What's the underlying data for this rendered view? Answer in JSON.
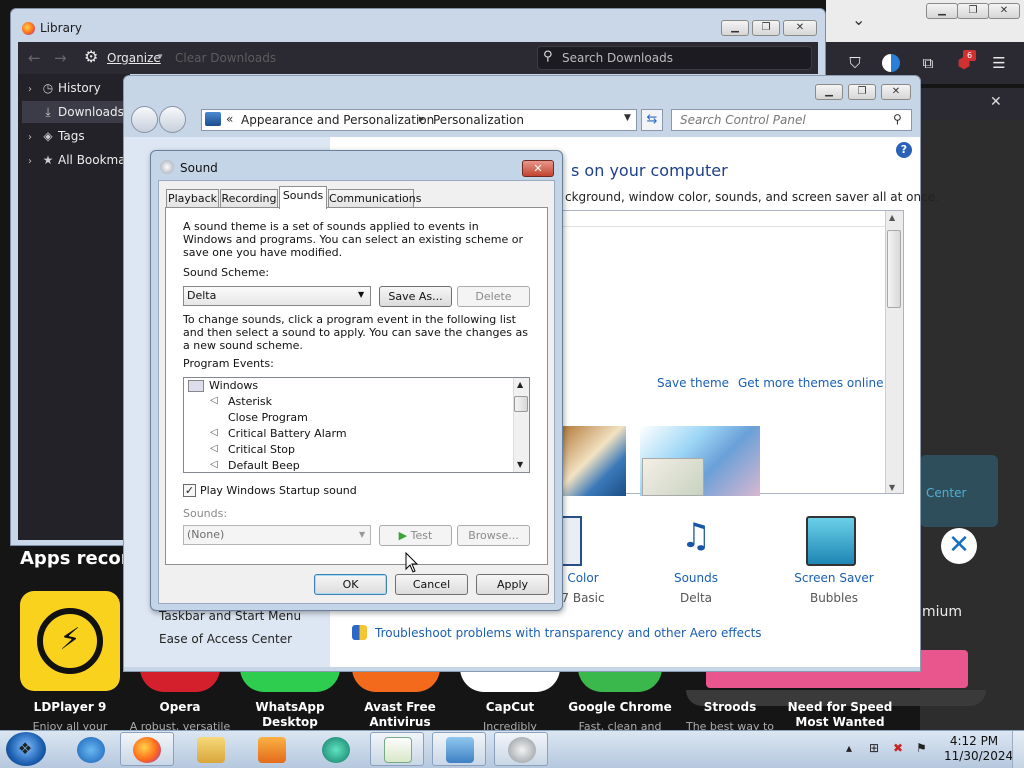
{
  "background": {
    "apps_title": "Apps recomm",
    "card_text": "Center",
    "premium_text": "mium",
    "apps": [
      {
        "name": "LDPlayer 9",
        "sub": "Enjoy all your"
      },
      {
        "name": "Opera",
        "sub": "A robust, versatile"
      },
      {
        "name": "WhatsApp Desktop",
        "sub": ""
      },
      {
        "name": "Avast Free Antivirus",
        "sub": ""
      },
      {
        "name": "CapCut",
        "sub": "Incredibly"
      },
      {
        "name": "Google Chrome",
        "sub": "Fast, clean and"
      },
      {
        "name": "Stroods",
        "sub": "The best way to"
      },
      {
        "name": "Need for Speed Most Wanted",
        "sub": ""
      }
    ],
    "notification_count": "6",
    "colors": {
      "pink_button": "#e8568d",
      "card": "#2f4e5b"
    }
  },
  "library": {
    "title": "Library",
    "organize": "Organize",
    "clear": "Clear Downloads",
    "search_placeholder": "Search Downloads",
    "sidebar": [
      {
        "label": "History",
        "icon": "clock-icon"
      },
      {
        "label": "Downloads",
        "icon": "download-icon"
      },
      {
        "label": "Tags",
        "icon": "tag-icon"
      },
      {
        "label": "All Bookma",
        "icon": "star-icon"
      }
    ]
  },
  "control_panel": {
    "breadcrumb_1": "Appearance and Personalization",
    "breadcrumb_2": "Personalization",
    "search_placeholder": "Search Control Panel",
    "heading": "s on your computer",
    "description": "ckground, window color, sounds, and screen saver all at once.",
    "save_theme": "Save theme",
    "more_themes": "Get more themes online",
    "items": [
      {
        "label": "Color",
        "value": "7 Basic"
      },
      {
        "label": "Sounds",
        "value": "Delta"
      },
      {
        "label": "Screen Saver",
        "value": "Bubbles"
      }
    ],
    "left_links": [
      "Taskbar and Start Menu",
      "Ease of Access Center"
    ],
    "troubleshoot": "Troubleshoot problems with transparency and other Aero effects"
  },
  "sound_dialog": {
    "title": "Sound",
    "close": "✕",
    "tabs": [
      "Playback",
      "Recording",
      "Sounds",
      "Communications"
    ],
    "active_tab": "Sounds",
    "intro": "A sound theme is a set of sounds applied to events in Windows and programs.  You can select an existing scheme or save one you have modified.",
    "scheme_label": "Sound Scheme:",
    "scheme_value": "Delta",
    "save_as": "Save As...",
    "delete": "Delete",
    "change_text": "To change sounds, click a program event in the following list and then select a sound to apply.  You can save the changes as a new sound scheme.",
    "events_label": "Program Events:",
    "events": [
      {
        "label": "Windows",
        "level": 0,
        "has_sound": false
      },
      {
        "label": "Asterisk",
        "level": 1,
        "has_sound": true
      },
      {
        "label": "Close Program",
        "level": 1,
        "has_sound": false
      },
      {
        "label": "Critical Battery Alarm",
        "level": 1,
        "has_sound": true
      },
      {
        "label": "Critical Stop",
        "level": 1,
        "has_sound": true
      },
      {
        "label": "Default Beep",
        "level": 1,
        "has_sound": true
      }
    ],
    "startup_label": "Play Windows Startup sound",
    "startup_checked": true,
    "sounds_label": "Sounds:",
    "sound_value": "(None)",
    "test": "Test",
    "browse": "Browse...",
    "ok": "OK",
    "cancel": "Cancel",
    "apply": "Apply"
  },
  "taskbar": {
    "time": "4:12 PM",
    "date": "11/30/2024",
    "apps": [
      "internet-explorer",
      "firefox",
      "file-explorer",
      "media-player",
      "app-teal",
      "notepad-chart",
      "control-panel",
      "sound"
    ]
  }
}
